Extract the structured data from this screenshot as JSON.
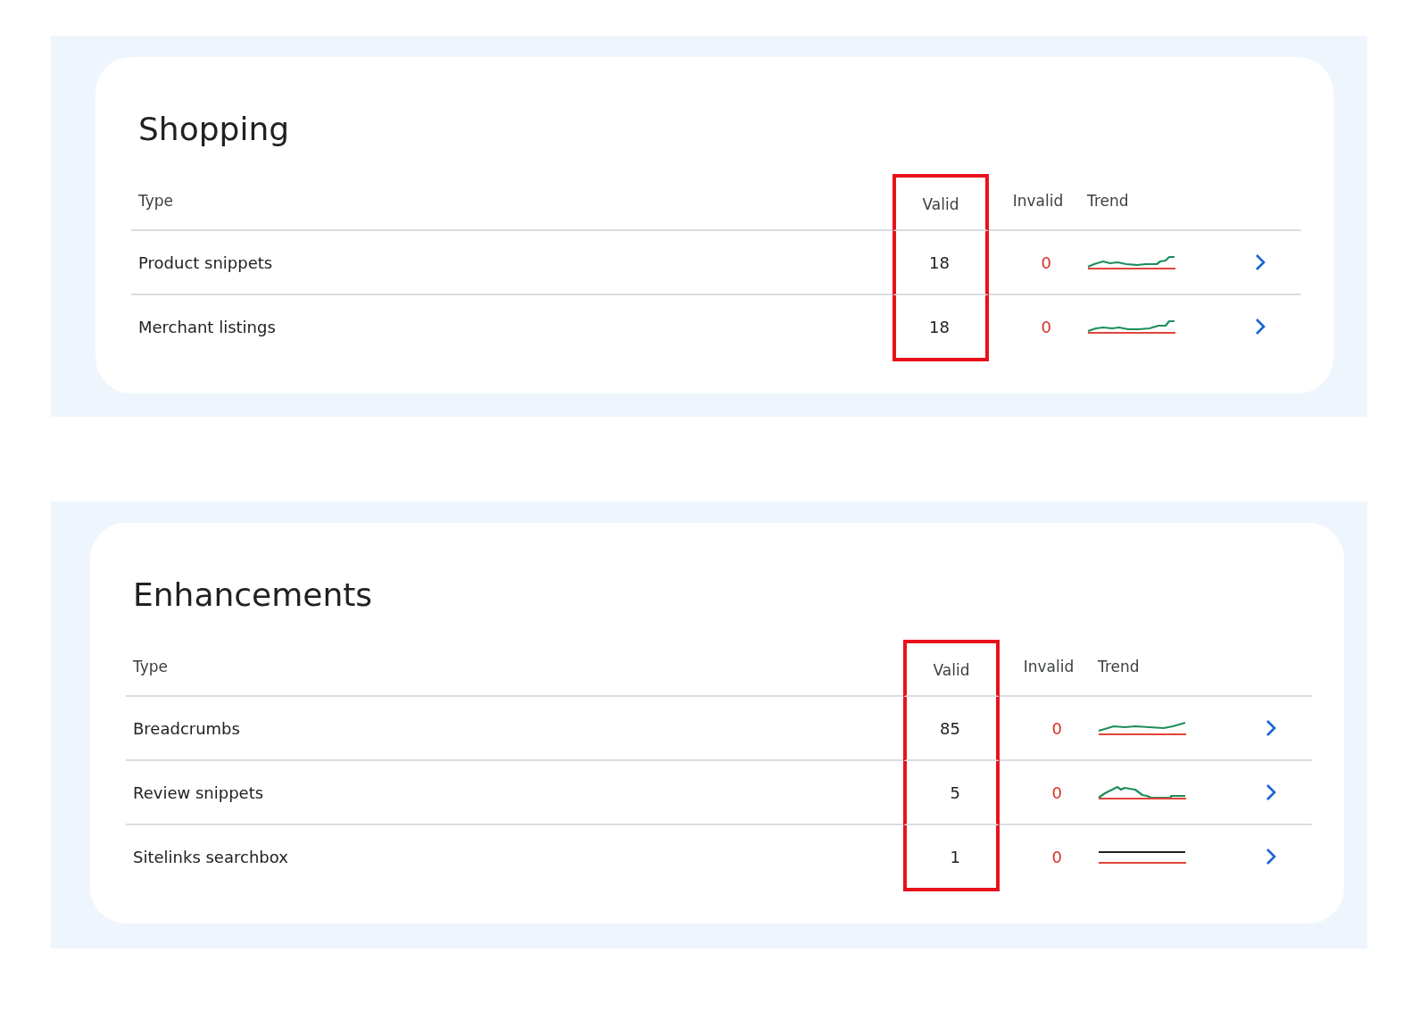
{
  "sections": [
    {
      "title": "Shopping",
      "columns": [
        {
          "label": "Type",
          "highlighted": false
        },
        {
          "label": "Valid",
          "highlighted": true
        },
        {
          "label": "Invalid",
          "highlighted": false
        },
        {
          "label": "Trend",
          "highlighted": false
        }
      ],
      "rows": [
        {
          "type": "Product snippets",
          "valid": "18",
          "invalid": "0"
        },
        {
          "type": "Merchant listings",
          "valid": "18",
          "invalid": "0"
        }
      ]
    },
    {
      "title": "Enhancements",
      "columns": [
        {
          "label": "Type",
          "highlighted": false
        },
        {
          "label": "Valid",
          "highlighted": true
        },
        {
          "label": "Invalid",
          "highlighted": false
        },
        {
          "label": "Trend",
          "highlighted": false
        }
      ],
      "rows": [
        {
          "type": "Breadcrumbs",
          "valid": "85",
          "invalid": "0"
        },
        {
          "type": "Review snippets",
          "valid": "5",
          "invalid": "0"
        },
        {
          "type": "Sitelinks searchbox",
          "valid": "1",
          "invalid": "0"
        }
      ]
    }
  ]
}
